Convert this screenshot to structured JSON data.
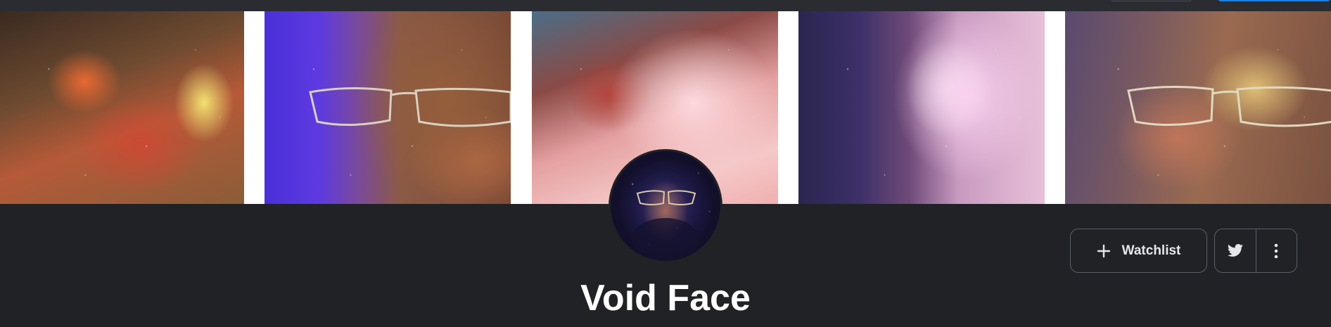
{
  "collection": {
    "name": "Void Face"
  },
  "actions": {
    "watchlist_label": "Watchlist",
    "watchlist_icon": "plus-icon",
    "share_icon": "twitter-icon",
    "more_icon": "more-vertical-icon"
  },
  "colors": {
    "background": "#202226",
    "text_primary": "#ffffff",
    "border": "#5a5e66",
    "accent": "#2081e2"
  }
}
